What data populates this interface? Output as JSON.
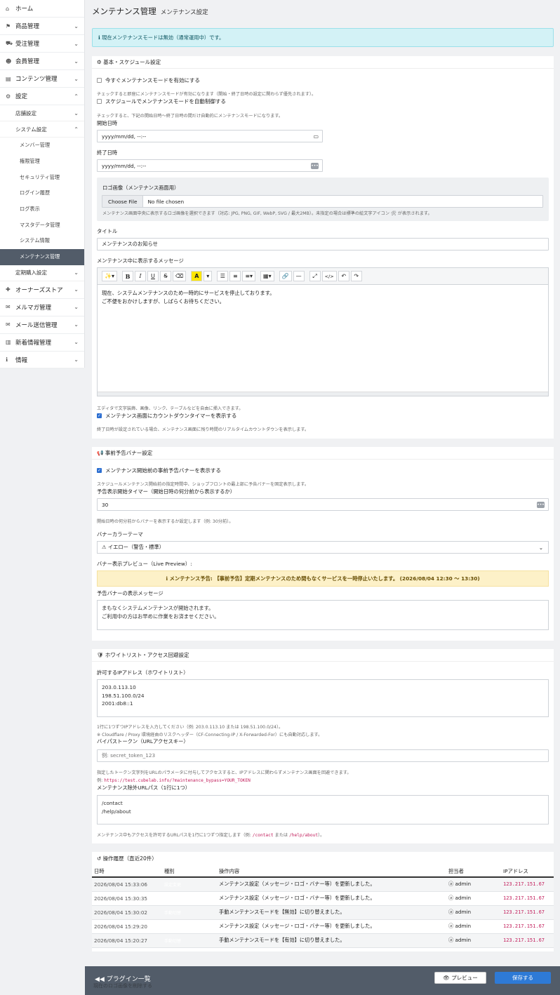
{
  "sidebar": {
    "items": [
      {
        "icon": "⌂",
        "label": "ホーム"
      },
      {
        "icon": "⚑",
        "label": "商品管理"
      },
      {
        "icon": "⛟",
        "label": "受注管理"
      },
      {
        "icon": "☻",
        "label": "会員管理"
      },
      {
        "icon": "▤",
        "label": "コンテンツ管理"
      },
      {
        "icon": "⚙",
        "label": "設定"
      }
    ],
    "settings_sub": {
      "store": "店舗設定",
      "system": "システム設定",
      "recurring": "定期購入設定"
    },
    "system_items": [
      "メンバー管理",
      "権限管理",
      "セキュリティ管理",
      "ログイン履歴",
      "ログ表示",
      "マスタデータ管理",
      "システム情報",
      "メンテナンス管理"
    ],
    "bottom_items": [
      {
        "icon": "✚",
        "label": "オーナーズストア"
      },
      {
        "icon": "✉",
        "label": "メルマガ管理"
      },
      {
        "icon": "✉",
        "label": "メール送信管理"
      },
      {
        "icon": "▥",
        "label": "新着情報管理"
      },
      {
        "icon": "ℹ",
        "label": "情報"
      }
    ]
  },
  "header": {
    "title": "メンテナンス管理",
    "subtitle": "メンテナンス設定"
  },
  "alert": "ℹ 現在メンテナンスモードは無効（通常運用中）です。",
  "basic": {
    "title": "⚙ 基本・スケジュール設定",
    "enable_now": "今すぐメンテナンスモードを有効にする",
    "enable_now_help": "チェックすると即座にメンテナンスモードが有効になります（開始・終了日時の設定に関わらず優先されます）。",
    "auto": "スケジュールでメンテナンスモードを自動制御する",
    "auto_help": "チェックすると、下記の開始日時〜終了日時の間だけ自動的にメンテナンスモードになります。",
    "start_label": "開始日時",
    "start_placeholder": "yyyy/mm/dd, --:--",
    "end_label": "終了日時",
    "end_placeholder": "yyyy/mm/dd, --:--",
    "logo_label": "ロゴ画像（メンテナンス画面用）",
    "choose_file": "Choose File",
    "no_file": "No file chosen",
    "logo_help": "メンテナンス画面中央に表示するロゴ画像を選択できます（対応: JPG, PNG, GIF, WebP, SVG / 最大2MB）。未指定の場合は標準の絵文字アイコン 🛠 が表示されます。",
    "title_label": "タイトル",
    "title_value": "メンテナンスのお知らせ",
    "message_label": "メンテナンス中に表示するメッセージ",
    "message_body": "現在、システムメンテナンスのため一時的にサービスを停止しております。\nご不便をおかけしますが、しばらくお待ちください。",
    "editor_help": "エディタで文字装飾、画像、リンク、テーブルなどを自由に挿入できます。",
    "countdown": "メンテナンス画面にカウントダウンタイマーを表示する",
    "countdown_help": "終了日時が設定されている場合、メンテナンス画面に残り時間のリアルタイムカウントダウンを表示します。"
  },
  "toolbar": {
    "magic": "✨▾",
    "bold": "B",
    "italic": "I",
    "underline": "U",
    "strike": "S",
    "eraser": "⌫",
    "color": "A",
    "ul": "☰",
    "ol": "≡",
    "align": "≡▾",
    "table": "▦▾",
    "link": "🔗",
    "hr": "—",
    "full": "⤢",
    "code": "</>",
    "undo": "↶",
    "redo": "↷"
  },
  "banner": {
    "title": "📢 事前予告バナー設定",
    "show": "メンテナンス開始前の事前予告バナーを表示する",
    "show_help": "スケジュールメンテナンス開始前の指定時間中、ショップフロントの最上部に予告バナーを固定表示します。",
    "timer_label": "予告表示開始タイマー（開始日時の何分前から表示するか）",
    "timer_value": "30",
    "timer_help": "開始日時の何分前からバナーを表示するか設定します（例: 30分前）。",
    "theme_label": "バナーカラーテーマ",
    "theme_value": "⚠ イエロー（警告・標準）",
    "preview_label": "バナー表示プレビュー（Live Preview）:",
    "preview_text": "ℹ メンテナンス予告: 【事前予告】定期メンテナンスのため間もなくサービスを一時停止いたします。 (2026/08/04 12:30 〜 13:30)",
    "msg_label": "予告バナーの表示メッセージ",
    "msg_value": "まもなくシステムメンテナンスが開始されます。\nご利用中の方はお早めに作業をお済ませください。"
  },
  "whitelist": {
    "title": "🛡 ホワイトリスト・アクセス回避設定",
    "ip_label": "許可するIPアドレス（ホワイトリスト）",
    "ip_value": "203.0.113.10\n198.51.100.0/24\n2001:db8::1",
    "ip_help1": "1行に1つずつIPアドレスを入力してください（例: 203.0.113.10 または 198.51.100.0/24）。",
    "ip_help2": "※ Cloudflare / Proxy 環境経由のリスクヘッダー（CF-Connecting-IP / X-Forwarded-For）にも自動対応します。",
    "token_label": "バイパストークン（URLアクセスキー）",
    "token_placeholder": "例: secret_token_123",
    "token_help": "指定したトークン文字列をURLのパラメータに付与してアクセスすると、IPアドレスに関わらずメンテナンス画面を回避できます。",
    "token_example_prefix": "例: ",
    "token_example": "https://test.cubelab.info/?maintenance_bypass=YOUR_TOKEN",
    "exclude_label": "メンテナンス除外URLパス（1行に1つ）",
    "exclude_value": "/contact\n/help/about",
    "exclude_help_a": "メンテナンス中もアクセスを許可するURLパスを1行に1つずつ指定します（例: ",
    "exclude_code1": "/contact",
    "exclude_help_b": " または ",
    "exclude_code2": "/help/about",
    "exclude_help_c": "）。"
  },
  "history": {
    "title": "↺ 操作履歴（直近20件）",
    "columns": [
      "日時",
      "種別",
      "操作内容",
      "担当者",
      "IPアドレス"
    ],
    "rows": [
      {
        "time": "2026/08/04 15:33:06",
        "type": "設定変更",
        "desc": "メンテナンス設定（メッセージ・ロゴ・バナー等）を更新しました。",
        "user": "ⓐ admin",
        "ip": "123.217.151.67"
      },
      {
        "time": "2026/08/04 15:30:35",
        "type": "設定変更",
        "desc": "メンテナンス設定（メッセージ・ロゴ・バナー等）を更新しました。",
        "user": "ⓐ admin",
        "ip": "123.217.151.67"
      },
      {
        "time": "2026/08/04 15:30:02",
        "type": "手動切替",
        "desc": "手動メンテナンスモードを【無効】に切り替えました。",
        "user": "ⓐ admin",
        "ip": "123.217.151.67"
      },
      {
        "time": "2026/08/04 15:29:20",
        "type": "設定変更",
        "desc": "メンテナンス設定（メッセージ・ロゴ・バナー等）を更新しました。",
        "user": "ⓐ admin",
        "ip": "123.217.151.67"
      },
      {
        "time": "2026/08/04 15:20:27",
        "type": "手動切替",
        "desc": "手動メンテナンスモードを【有効】に切り替えました。",
        "user": "ⓐ admin",
        "ip": "123.217.151.67"
      }
    ]
  },
  "footer": {
    "back": "◀◀  プラグイン一覧",
    "sub": "現在のロゴ画像を削除する",
    "preview": "👁 プレビュー",
    "save": "保存する"
  }
}
